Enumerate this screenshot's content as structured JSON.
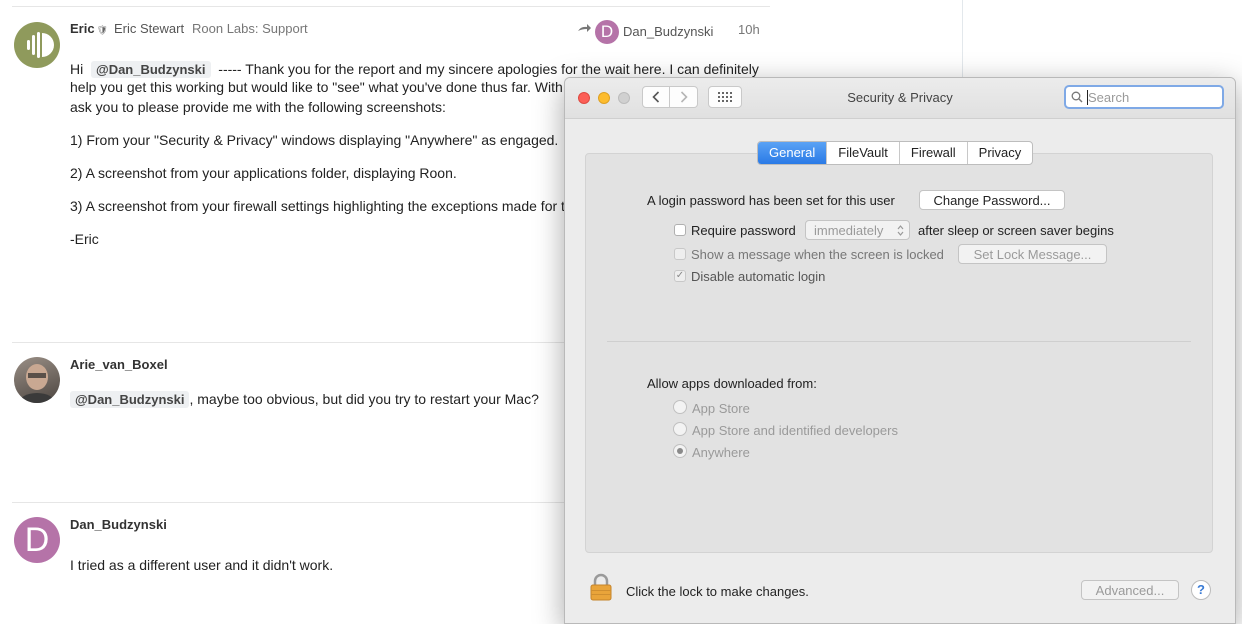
{
  "forum": {
    "posts": [
      {
        "username": "Eric",
        "staff_badge": "🛡",
        "full_name": "Eric Stewart",
        "title": "Roon Labs: Support",
        "reply_to": "Dan_Budzynski",
        "reply_to_avatar_letter": "D",
        "time": "10h",
        "greeting": "Hi",
        "mention": "@Dan_Budzynski",
        "line1_rest": "----- Thank you for the report and my sincere apologies for the wait here. I can definitely",
        "line2": "help you get this working but would like to \"see\" what you've done thus far. With",
        "line3": "ask you to please provide me with the following screenshots:",
        "item1": "1) From your \"Security & Privacy\" windows displaying \"Anywhere\" as engaged.",
        "item2": "2) A screenshot from your applications folder, displaying Roon.",
        "item3": "3) A screenshot from your firewall settings highlighting the exceptions made for t",
        "signoff": "-Eric"
      },
      {
        "username": "Arie_van_Boxel",
        "mention": "@Dan_Budzynski",
        "text": ", maybe too obvious, but did you try to restart your Mac?"
      },
      {
        "username": "Dan_Budzynski",
        "avatar_letter": "D",
        "text": "I tried as a different user and it didn't work."
      }
    ]
  },
  "window": {
    "title": "Security & Privacy",
    "search_placeholder": "Search",
    "grid_icon": "⋮⋮⋮",
    "tabs": [
      {
        "label": "General",
        "active": true
      },
      {
        "label": "FileVault",
        "active": false
      },
      {
        "label": "Firewall",
        "active": false
      },
      {
        "label": "Privacy",
        "active": false
      }
    ],
    "login_password_text": "A login password has been set for this user",
    "change_password_label": "Change Password...",
    "require_password_label": "Require password",
    "require_password_value": "immediately",
    "after_sleep_text": "after sleep or screen saver begins",
    "show_message_label": "Show a message when the screen is locked",
    "set_lock_message_label": "Set Lock Message...",
    "disable_auto_login_label": "Disable automatic login",
    "allow_apps_label": "Allow apps downloaded from:",
    "radio_options": [
      {
        "label": "App Store",
        "selected": false
      },
      {
        "label": "App Store and identified developers",
        "selected": false
      },
      {
        "label": "Anywhere",
        "selected": true
      }
    ],
    "lock_text": "Click the lock to make changes.",
    "advanced_label": "Advanced...",
    "help_label": "?"
  },
  "colors": {
    "tab_active": "#2a7ae6",
    "close": "#fc5f57",
    "minimize": "#fdbc2e",
    "avatar_eric": "#8f9a5c",
    "avatar_dan": "#b573a8",
    "lock": "#e9a43a"
  }
}
